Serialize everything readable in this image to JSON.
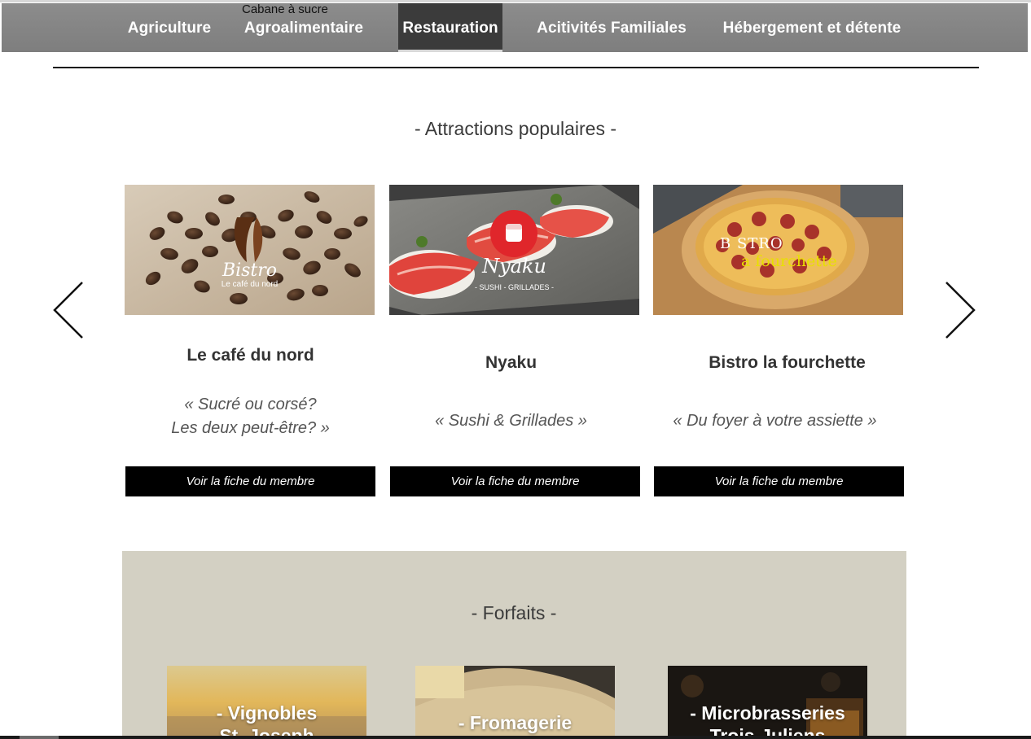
{
  "nav": {
    "items": [
      {
        "label": "Agriculture"
      },
      {
        "label": "Agroalimentaire"
      },
      {
        "label": "Restauration"
      },
      {
        "label": "Acitivités Familiales"
      },
      {
        "label": "Hébergement et détente"
      }
    ],
    "overlay_text": "Cabane à sucre",
    "active": "Restauration"
  },
  "attractions": {
    "title": "- Attractions populaires -",
    "cards": [
      {
        "name": "Le café du nord",
        "quote_line1": "« Sucré ou corsé?",
        "quote_line2": "Les deux peut-être? »",
        "button": "Voir la fiche du membre",
        "logo_main": "Bistro",
        "logo_sub": "Le café du nord"
      },
      {
        "name": "Nyaku",
        "quote_line1": "« Sushi & Grillades »",
        "button": "Voir la fiche du membre",
        "logo_main": "Nyaku",
        "logo_sub": "- SUSHI - GRILLADES -"
      },
      {
        "name": "Bistro la fourchette",
        "quote_line1": "« Du foyer à votre assiette »",
        "button": "Voir la fiche du membre",
        "logo_main": "B STRO",
        "logo_sub": "a fourchette"
      }
    ]
  },
  "forfaits": {
    "title": "- Forfaits -",
    "items": [
      {
        "line1": "- Vignobles",
        "line2": "St. Joseph"
      },
      {
        "line1": "- Fromagerie",
        "line2": ""
      },
      {
        "line1": "- Microbrasseries",
        "line2": "Trois-Juliens"
      }
    ]
  },
  "colors": {
    "nav_bg": "#838383",
    "nav_active": "#3b3b3b",
    "button_bg": "#000000",
    "forfaits_bg": "#d3d0c3"
  }
}
